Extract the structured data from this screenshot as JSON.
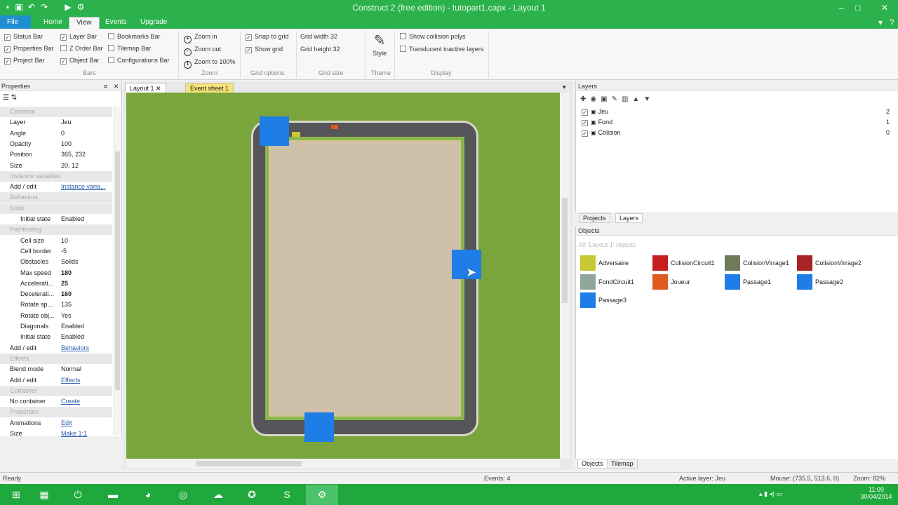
{
  "window": {
    "title": "Construct 2  (free edition) - tutopart1.capx - Layout 1"
  },
  "ribbon_tabs": {
    "file": "File",
    "home": "Home",
    "view": "View",
    "events": "Events",
    "upgrade": "Upgrade"
  },
  "ribbon": {
    "bars": {
      "status_bar": "Status Bar",
      "properties_bar": "Properties Bar",
      "project_bar": "Project Bar",
      "layer_bar": "Layer Bar",
      "z_order_bar": "Z Order Bar",
      "object_bar": "Object Bar",
      "bookmarks_bar": "Bookmarks Bar",
      "tilemap_bar": "Tilemap Bar",
      "configurations_bar": "Configurations Bar",
      "group": "Bars"
    },
    "zoom": {
      "zoom_in": "Zoom in",
      "zoom_out": "Zoom out",
      "zoom_100": "Zoom to 100%",
      "group": "Zoom"
    },
    "grid": {
      "snap": "Snap to grid",
      "show": "Show grid",
      "group": "Grid options"
    },
    "grid_size": {
      "width": "Grid width 32",
      "height": "Grid height 32",
      "group": "Grid size"
    },
    "theme": {
      "style": "Style",
      "group": "Theme"
    },
    "display": {
      "collision": "Show collision polys",
      "translucent": "Translucent inactive layers",
      "group": "Display"
    }
  },
  "properties": {
    "title": "Properties",
    "rows": [
      {
        "k": "Common",
        "type": "sec"
      },
      {
        "k": "Layer",
        "v": "Jeu"
      },
      {
        "k": "Angle",
        "v": "0"
      },
      {
        "k": "Opacity",
        "v": "100"
      },
      {
        "k": "Position",
        "v": "365, 232"
      },
      {
        "k": "Size",
        "v": "20, 12"
      },
      {
        "k": "Instance variables",
        "type": "sec"
      },
      {
        "k": "Add / edit",
        "v": "Instance varia...",
        "link": true
      },
      {
        "k": "Behaviors",
        "type": "sec"
      },
      {
        "k": "Solid",
        "type": "sec"
      },
      {
        "k": "Initial state",
        "v": "Enabled",
        "type": "sub"
      },
      {
        "k": "Pathfinding",
        "type": "sec"
      },
      {
        "k": "Cell size",
        "v": "10",
        "type": "sub"
      },
      {
        "k": "Cell border",
        "v": "-5",
        "type": "sub"
      },
      {
        "k": "Obstacles",
        "v": "Solids",
        "type": "sub"
      },
      {
        "k": "Max speed",
        "v": "180",
        "type": "sub",
        "bold": true
      },
      {
        "k": "Accelerati...",
        "v": "25",
        "type": "sub",
        "bold": true
      },
      {
        "k": "Decelerati...",
        "v": "160",
        "type": "sub",
        "bold": true
      },
      {
        "k": "Rotate sp...",
        "v": "135",
        "type": "sub"
      },
      {
        "k": "Rotate obj...",
        "v": "Yes",
        "type": "sub"
      },
      {
        "k": "Diagonals",
        "v": "Enabled",
        "type": "sub"
      },
      {
        "k": "Initial state",
        "v": "Enabled",
        "type": "sub"
      },
      {
        "k": "Add / edit",
        "v": "Behaviors",
        "link": true
      },
      {
        "k": "Effects",
        "type": "sec"
      },
      {
        "k": "Blend mode",
        "v": "Normal"
      },
      {
        "k": "Add / edit",
        "v": "Effects",
        "link": true
      },
      {
        "k": "Container",
        "type": "sec"
      },
      {
        "k": "No container",
        "v": "Create",
        "link": true
      },
      {
        "k": "Properties",
        "type": "sec"
      },
      {
        "k": "Animations",
        "v": "Edit",
        "link": true
      },
      {
        "k": "Size",
        "v": "Make 1:1",
        "link": true
      }
    ]
  },
  "editor_tabs": {
    "layout": "Layout 1",
    "events": "Event sheet 1"
  },
  "layers_panel": {
    "title": "Layers",
    "layers": [
      {
        "name": "Jeu",
        "index": "2"
      },
      {
        "name": "Fond",
        "index": "1"
      },
      {
        "name": "Colision",
        "index": "0"
      }
    ],
    "tabs": {
      "projects": "Projects",
      "layers": "Layers"
    }
  },
  "objects_panel": {
    "title": "Objects",
    "filter": "All 'Layout 1' objects",
    "objects": [
      {
        "name": "Adversaire",
        "color": "#c8c832"
      },
      {
        "name": "ColisionCircuit1",
        "color": "#c81e1e"
      },
      {
        "name": "ColisionVirrage1",
        "color": "#6e7a5a"
      },
      {
        "name": "ColisionVirrage2",
        "color": "#a82424"
      },
      {
        "name": "FondCircuit1",
        "color": "#8fa79a"
      },
      {
        "name": "Joueur",
        "color": "#e05a1e"
      },
      {
        "name": "Passage1",
        "color": "#1e7de6"
      },
      {
        "name": "Passage2",
        "color": "#1e7de6"
      },
      {
        "name": "Passage3",
        "color": "#1e7de6"
      }
    ],
    "tabs": {
      "objects": "Objects",
      "tilemap": "Tilemap"
    }
  },
  "status": {
    "ready": "Ready",
    "events": "Events: 4",
    "active_layer": "Active layer: Jeu",
    "mouse": "Mouse: (735.5, 513.6, 0)",
    "zoom": "Zoom: 82%"
  },
  "taskbar": {
    "time": "11:09",
    "date": "30/04/2014"
  }
}
